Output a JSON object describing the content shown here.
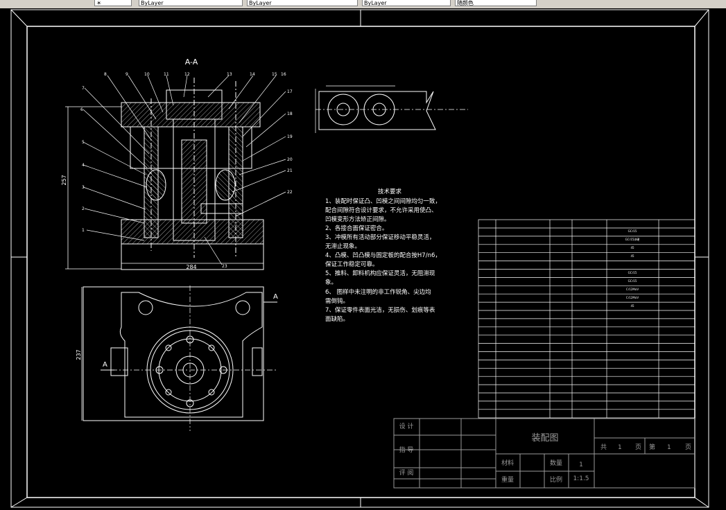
{
  "toolbar": {
    "layer_combo": "ByLayer",
    "linetype_combo": "ByLayer",
    "lineweight_combo": "ByLayer",
    "plotstyle_combo": "随颜色"
  },
  "section_label": "A-A",
  "dimensions": {
    "height_top": "257",
    "width_top": "284",
    "height_bottom": "237"
  },
  "section_mark": "A",
  "callouts": [
    "1",
    "2",
    "3",
    "4",
    "5",
    "6",
    "7",
    "8",
    "9",
    "10",
    "11",
    "12",
    "13",
    "14",
    "15",
    "16",
    "17",
    "18",
    "19",
    "20",
    "21",
    "22",
    "23"
  ],
  "tech_requirements": {
    "title": "技术要求",
    "lines": [
      "1、装配时保证凸、凹模之间间隙均匀一致，",
      "配合间隙符合设计要求，不允许采用使凸、",
      "凹模变形方法矫正间隙。",
      "2、各接合面保证密合。",
      "3、冲模所有活动部分保证移动平稳灵活，",
      "无滞止现象。",
      "4、凸模、凹凸模与固定板的配合按H7/n6，",
      "保证工作稳定可靠。",
      "5、推料、卸料机构应保证灵活，无阻滞现",
      "象。",
      "6、 图样中未注明的非工作锐角、尖边均",
      "需倒钝。",
      "7、保证零件表面光洁，无损伤、划痕等表",
      "面缺陷。"
    ]
  },
  "parts_list_material_notes": [
    "GCr15",
    "GCr15淬硬",
    "45",
    "45",
    "GCr15",
    "GCr15",
    "Cr12MoV",
    "Cr12MoV",
    "45"
  ],
  "title_block": {
    "design_label": "设 计",
    "check_label": "指 导",
    "review_label": "评 阅",
    "drawing_name": "装配图",
    "total_label": "共",
    "total_pages": "1",
    "page_unit": "页",
    "sheet_label": "第",
    "sheet_no": "1",
    "sheet_unit": "页",
    "material_label": "材料",
    "quantity_label": "数量",
    "quantity_value": "1",
    "weight_label": "重量",
    "scale_label": "比例",
    "scale_value": "1:1.5"
  },
  "colors": {
    "background": "#000000",
    "lines": "#ffffff",
    "title_block_lines": "#9a9a9a",
    "hatch": "#c8c8c8"
  }
}
